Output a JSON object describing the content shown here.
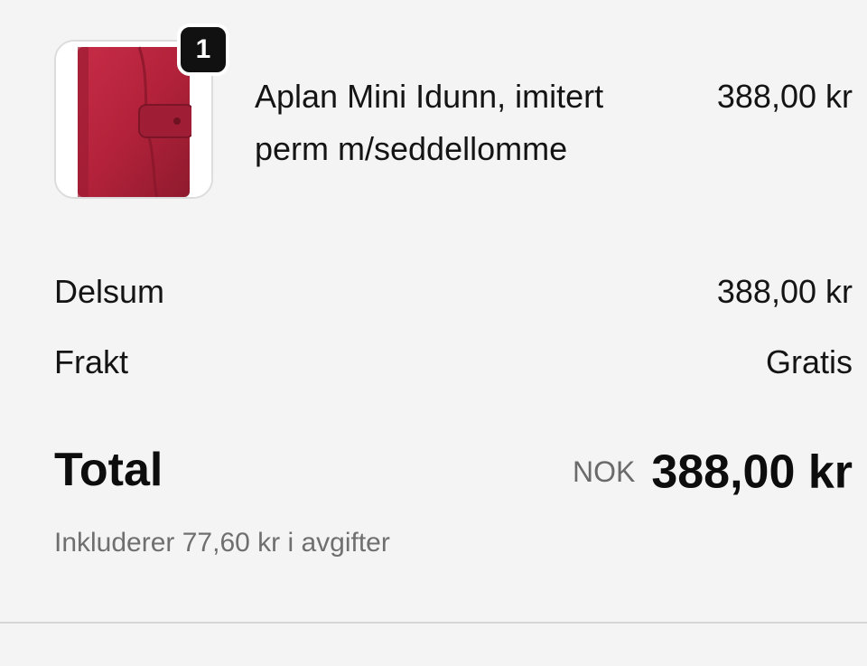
{
  "line_item": {
    "quantity": "1",
    "title": "Aplan Mini Idunn, imitert perm m/seddellomme",
    "price": "388,00 kr",
    "image_color": "#b3223a"
  },
  "summary": {
    "subtotal_label": "Delsum",
    "subtotal_value": "388,00 kr",
    "shipping_label": "Frakt",
    "shipping_value": "Gratis",
    "total_label": "Total",
    "currency_code": "NOK",
    "total_value": "388,00 kr",
    "tax_note": "Inkluderer 77,60 kr i avgifter"
  }
}
